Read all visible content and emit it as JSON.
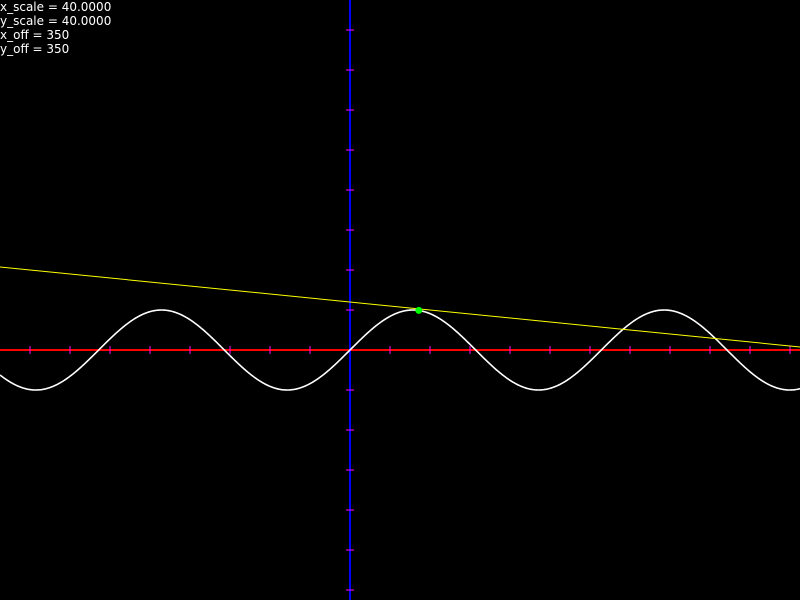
{
  "readout": {
    "x_scale": "x_scale = 40.0000",
    "y_scale": "y_scale = 40.0000",
    "x_off": "x_off = 350",
    "y_off": "y_off = 350"
  },
  "colors": {
    "background": "#000000",
    "x_axis": "#ff0000",
    "y_axis": "#0000ff",
    "ticks": "#ff00ff",
    "curve": "#ffffff",
    "tangent": "#ffff00",
    "point": "#00ff00",
    "text": "#ffffff"
  },
  "chart_data": {
    "type": "line",
    "title": "",
    "xlabel": "",
    "ylabel": "",
    "scale": {
      "x": 40,
      "y": 40
    },
    "offset": {
      "x": 350,
      "y": 350
    },
    "xlim": [
      -8.75,
      11.25
    ],
    "ylim": [
      -6.25,
      8.75
    ],
    "tick_step": 1,
    "grid": false,
    "legend": "none",
    "series": [
      {
        "function": "sin(x)",
        "color": "#ffffff"
      },
      {
        "kind": "tangent",
        "slope": -0.1,
        "intercept": 1.2,
        "color": "#ffff00"
      }
    ],
    "points": [
      {
        "x": 1.72,
        "y": 0.99,
        "color": "#00ff00"
      }
    ]
  }
}
